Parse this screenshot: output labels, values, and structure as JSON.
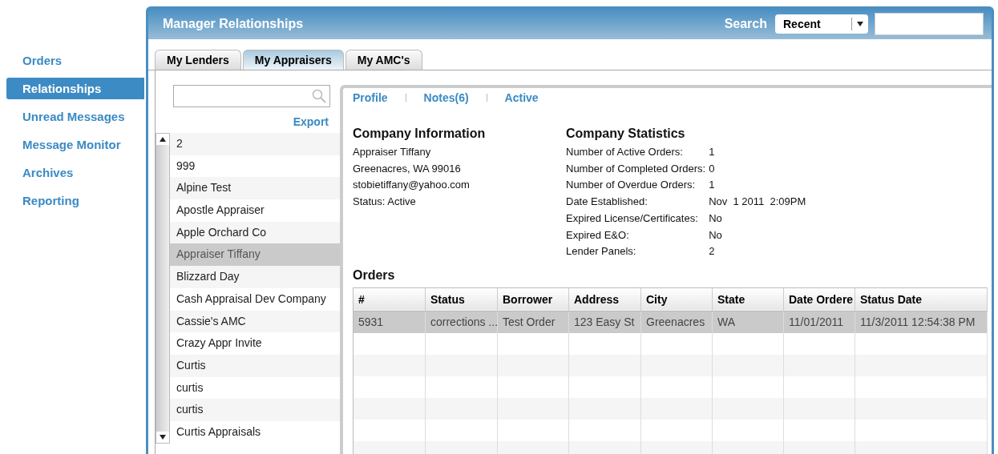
{
  "nav": [
    {
      "label": "Orders",
      "selected": false
    },
    {
      "label": "Relationships",
      "selected": true
    },
    {
      "label": "Unread Messages",
      "selected": false
    },
    {
      "label": "Message Monitor",
      "selected": false
    },
    {
      "label": "Archives",
      "selected": false
    },
    {
      "label": "Reporting",
      "selected": false
    }
  ],
  "window": {
    "title": "Manager Relationships"
  },
  "search": {
    "label": "Search",
    "dropdown": "Recent"
  },
  "tabs": [
    {
      "label": "My Lenders",
      "selected": false
    },
    {
      "label": "My Appraisers",
      "selected": true
    },
    {
      "label": "My AMC's",
      "selected": false
    }
  ],
  "list": {
    "export": "Export",
    "items": [
      {
        "label": "2",
        "selected": false
      },
      {
        "label": "999",
        "selected": false
      },
      {
        "label": "Alpine Test",
        "selected": false
      },
      {
        "label": "Apostle Appraiser",
        "selected": false
      },
      {
        "label": "Apple Orchard Co",
        "selected": false
      },
      {
        "label": "Appraiser Tiffany",
        "selected": true
      },
      {
        "label": "Blizzard Day",
        "selected": false
      },
      {
        "label": "Cash Appraisal Dev Company",
        "selected": false
      },
      {
        "label": "Cassie's AMC",
        "selected": false
      },
      {
        "label": "Crazy Appr Invite",
        "selected": false
      },
      {
        "label": "Curtis",
        "selected": false
      },
      {
        "label": "curtis",
        "selected": false
      },
      {
        "label": "curtis",
        "selected": false
      },
      {
        "label": "Curtis Appraisals",
        "selected": false
      }
    ]
  },
  "links": [
    "Profile",
    "Notes(6)",
    "Active"
  ],
  "company_info": {
    "title": "Company Information",
    "lines": [
      "Appraiser Tiffany",
      "Greenacres, WA 99016",
      "stobietiffany@yahoo.com",
      "Status: Active"
    ]
  },
  "company_stats": {
    "title": "Company Statistics",
    "rows": [
      {
        "label": "Number of Active Orders:",
        "value": "1"
      },
      {
        "label": "Number of Completed Orders:",
        "value": "0"
      },
      {
        "label": "Number of Overdue Orders:",
        "value": "1"
      },
      {
        "label": "Date Established:",
        "value": "Nov  1 2011  2:09PM"
      },
      {
        "label": "Expired License/Certificates:",
        "value": "No"
      },
      {
        "label": "Expired E&O:",
        "value": "No"
      },
      {
        "label": "Lender Panels:",
        "value": "2"
      }
    ]
  },
  "orders": {
    "title": "Orders",
    "columns": [
      "#",
      "Status",
      "Borrower",
      "Address",
      "City",
      "State",
      "Date Ordere",
      "Status Date"
    ],
    "rows": [
      {
        "cells": [
          "5931",
          "corrections ...",
          "Test Order",
          "123 Easy St",
          "Greenacres",
          "WA",
          "11/01/2011",
          "11/3/2011 12:54:38 PM"
        ],
        "selected": true
      }
    ]
  }
}
